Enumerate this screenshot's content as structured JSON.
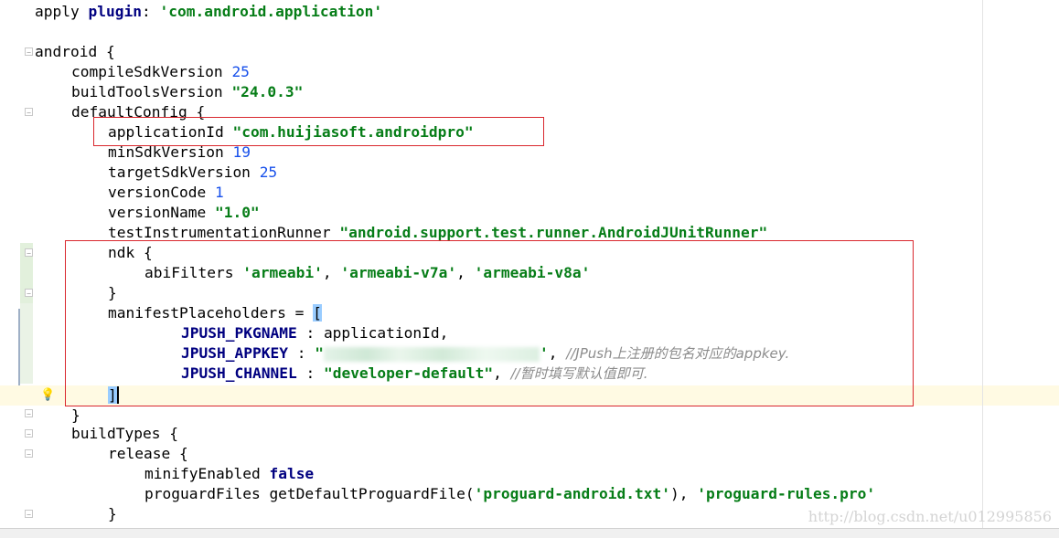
{
  "code": {
    "l1": {
      "a": "apply ",
      "b": "plugin",
      "c": ": ",
      "d": "'com.android.application'"
    },
    "l3": "android {",
    "l4": {
      "a": "compileSdkVersion ",
      "b": "25"
    },
    "l5": {
      "a": "buildToolsVersion ",
      "b": "\"24.0.3\""
    },
    "l6": "defaultConfig {",
    "l7": {
      "a": "applicationId ",
      "b": "\"com.huijiasoft.androidpro\""
    },
    "l8": {
      "a": "minSdkVersion ",
      "b": "19"
    },
    "l9": {
      "a": "targetSdkVersion ",
      "b": "25"
    },
    "l10": {
      "a": "versionCode ",
      "b": "1"
    },
    "l11": {
      "a": "versionName ",
      "b": "\"1.0\""
    },
    "l12": {
      "a": "testInstrumentationRunner ",
      "b": "\"android.support.test.runner.AndroidJUnitRunner\""
    },
    "l13": "ndk {",
    "l14": {
      "a": "abiFilters ",
      "b": "'armeabi'",
      "c": ", ",
      "d": "'armeabi-v7a'",
      "e": ", ",
      "f": "'armeabi-v8a'"
    },
    "l15": "}",
    "l16": {
      "a": "manifestPlaceholders = ",
      "b": "["
    },
    "l17": {
      "a": "JPUSH_PKGNAME",
      "b": " : applicationId,"
    },
    "l18": {
      "a": "JPUSH_APPKEY",
      "b": " : ",
      "c": "\"",
      "d": "'",
      "e": ", ",
      "f": "//JPush上注册的包名对应的appkey."
    },
    "l19": {
      "a": "JPUSH_CHANNEL",
      "b": " : ",
      "c": "\"developer-default\"",
      "d": ", ",
      "e": "//暂时填写默认值即可."
    },
    "l20": "]",
    "l21": "}",
    "l22": "buildTypes {",
    "l23": "release {",
    "l24": {
      "a": "minifyEnabled ",
      "b": "false"
    },
    "l25": {
      "a": "proguardFiles getDefaultProguardFile(",
      "b": "'proguard-android.txt'",
      "c": "), ",
      "d": "'proguard-rules.pro'"
    },
    "l26": "}"
  },
  "watermark": "http://blog.csdn.net/u012995856",
  "colors": {
    "string": "#067d17",
    "number": "#1750eb",
    "keyword": "#000080",
    "comment": "#8c8c8c",
    "highlight": "#d9272e"
  },
  "icons": {
    "intention": "lightbulb-icon"
  }
}
